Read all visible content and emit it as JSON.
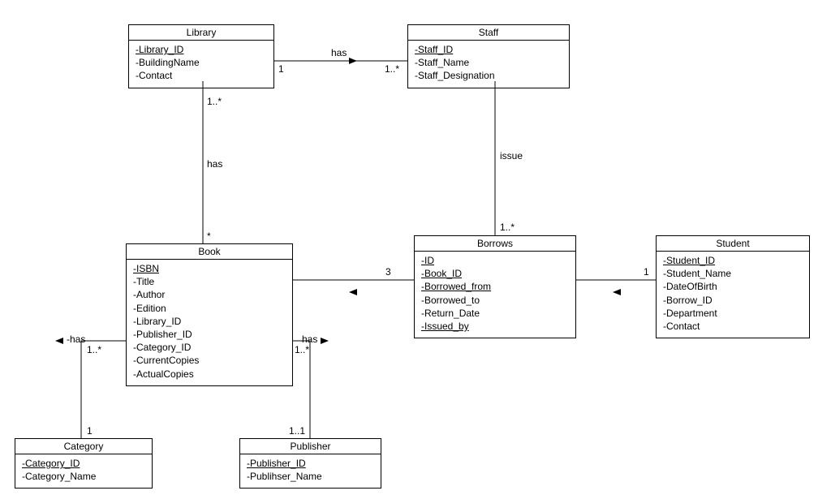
{
  "chart_data": {
    "type": "uml-class-diagram",
    "classes": [
      {
        "name": "Library",
        "attributes": [
          "Library_ID",
          "BuildingName",
          "Contact"
        ],
        "keys": [
          "Library_ID"
        ]
      },
      {
        "name": "Staff",
        "attributes": [
          "Staff_ID",
          "Staff_Name",
          "Staff_Designation"
        ],
        "keys": [
          "Staff_ID"
        ]
      },
      {
        "name": "Book",
        "attributes": [
          "ISBN",
          "Title",
          "Author",
          "Edition",
          "Library_ID",
          "Publisher_ID",
          "Category_ID",
          "CurrentCopies",
          "ActualCopies"
        ],
        "keys": [
          "ISBN"
        ]
      },
      {
        "name": "Borrows",
        "attributes": [
          "ID",
          "Book_ID",
          "Borrowed_from",
          "Borrowed_to",
          "Return_Date",
          "Issued_by"
        ],
        "keys": [
          "ID",
          "Book_ID",
          "Borrowed_from",
          "Issued_by"
        ]
      },
      {
        "name": "Student",
        "attributes": [
          "Student_ID",
          "Student_Name",
          "DateOfBirth",
          "Borrow_ID",
          "Department",
          "Contact"
        ],
        "keys": [
          "Student_ID"
        ]
      },
      {
        "name": "Category",
        "attributes": [
          "Category_ID",
          "Category_Name"
        ],
        "keys": [
          "Category_ID"
        ]
      },
      {
        "name": "Publisher",
        "attributes": [
          "Publisher_ID",
          "Publihser_Name"
        ],
        "keys": [
          "Publisher_ID"
        ]
      }
    ],
    "associations": [
      {
        "label": "has",
        "direction": "Library→Staff",
        "ends": {
          "Library": "1",
          "Staff": "1..*"
        }
      },
      {
        "label": "has",
        "direction": "Library→Book",
        "ends": {
          "Library": "1..*",
          "Book": "*"
        }
      },
      {
        "label": "issue",
        "direction": "Staff→Borrows",
        "ends": {
          "Borrows": "1..*"
        }
      },
      {
        "label": "",
        "direction": "Borrows→Book",
        "ends": {
          "Book": "3"
        }
      },
      {
        "label": "",
        "direction": "Borrows→Student",
        "ends": {
          "Student": "1"
        }
      },
      {
        "label": "has",
        "direction": "Category→Book",
        "ends": {
          "Book": "1..*",
          "Category": "1"
        }
      },
      {
        "label": "has",
        "direction": "Book→Publisher",
        "ends": {
          "Book": "1..*",
          "Publisher": "1..1"
        }
      }
    ]
  },
  "classes": {
    "library": {
      "title": "Library",
      "a0": "-Library_ID",
      "a1": "-BuildingName",
      "a2": "-Contact"
    },
    "staff": {
      "title": "Staff",
      "a0": "-Staff_ID",
      "a1": "-Staff_Name",
      "a2": "-Staff_Designation"
    },
    "book": {
      "title": "Book",
      "a0": "-ISBN",
      "a1": "-Title",
      "a2": "-Author",
      "a3": "-Edition",
      "a4": "-Library_ID",
      "a5": "-Publisher_ID",
      "a6": "-Category_ID",
      "a7": "-CurrentCopies",
      "a8": "-ActualCopies"
    },
    "borrows": {
      "title": "Borrows",
      "a0": "-ID",
      "a1": "-Book_ID",
      "a2": "-Borrowed_from",
      "a3": "-Borrowed_to",
      "a4": "-Return_Date",
      "a5": "-Issued_by"
    },
    "student": {
      "title": "Student",
      "a0": "-Student_ID",
      "a1": "-Student_Name",
      "a2": "-DateOfBirth",
      "a3": "-Borrow_ID",
      "a4": "-Department",
      "a5": "-Contact"
    },
    "category": {
      "title": "Category",
      "a0": "-Category_ID",
      "a1": "-Category_Name"
    },
    "publisher": {
      "title": "Publisher",
      "a0": "-Publisher_ID",
      "a1": "-Publihser_Name"
    }
  },
  "relLabels": {
    "libStaff_has": "has",
    "libStaff_1": "1",
    "libStaff_1s": "1..*",
    "libBook_has": "has",
    "libBook_1s": "1..*",
    "libBook_star": "*",
    "staffBorrows_issue": "issue",
    "staffBorrows_1s": "1..*",
    "borrowsBook_3": "3",
    "borrowsStudent_1": "1",
    "bookCategory_has": "has",
    "bookCategory_1s": "1..*",
    "bookCategory_1": "1",
    "bookPublisher_has": "has",
    "bookPublisher_1s": "1..*",
    "bookPublisher_11": "1..1"
  }
}
